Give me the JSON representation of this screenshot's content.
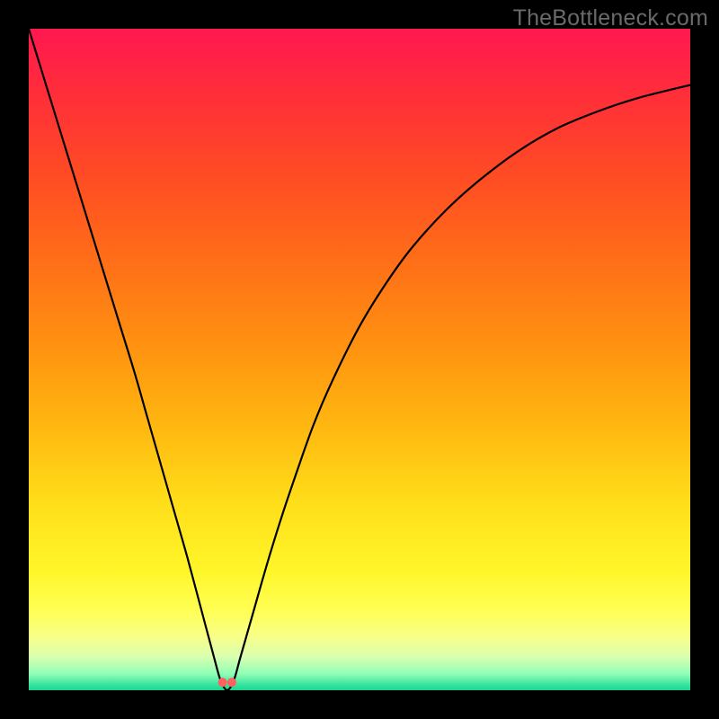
{
  "watermark": "TheBottleneck.com",
  "chart_data": {
    "type": "line",
    "title": "",
    "xlabel": "",
    "ylabel": "",
    "xlim": [
      0,
      100
    ],
    "ylim": [
      0,
      100
    ],
    "grid": false,
    "legend": false,
    "background_gradient_stops": [
      {
        "offset": 0.0,
        "color": "#ff1850"
      },
      {
        "offset": 0.1,
        "color": "#ff2e39"
      },
      {
        "offset": 0.22,
        "color": "#ff4b24"
      },
      {
        "offset": 0.35,
        "color": "#ff6e18"
      },
      {
        "offset": 0.48,
        "color": "#ff9210"
      },
      {
        "offset": 0.6,
        "color": "#ffb710"
      },
      {
        "offset": 0.72,
        "color": "#ffdf1a"
      },
      {
        "offset": 0.82,
        "color": "#fff62a"
      },
      {
        "offset": 0.88,
        "color": "#ffff55"
      },
      {
        "offset": 0.92,
        "color": "#f8ff8a"
      },
      {
        "offset": 0.95,
        "color": "#d8ffb0"
      },
      {
        "offset": 0.975,
        "color": "#90ffb6"
      },
      {
        "offset": 0.99,
        "color": "#40e6a0"
      },
      {
        "offset": 1.0,
        "color": "#18d690"
      }
    ],
    "series": [
      {
        "name": "bottleneck-curve",
        "x": [
          0,
          2,
          4,
          6,
          8,
          10,
          12,
          14,
          16,
          18,
          20,
          22,
          24,
          26,
          28,
          29,
          30,
          31,
          32,
          34,
          36,
          38,
          40,
          43,
          46,
          50,
          54,
          58,
          63,
          68,
          74,
          80,
          86,
          92,
          100
        ],
        "y": [
          100,
          93.5,
          87,
          80.5,
          74,
          67.5,
          61,
          54.5,
          48,
          41,
          34,
          27,
          20,
          12.5,
          5,
          1.5,
          0,
          1.5,
          5,
          12,
          19,
          25.5,
          31.5,
          40,
          47,
          55,
          61.5,
          67,
          72.5,
          77,
          81.5,
          85,
          87.5,
          89.5,
          91.5
        ]
      }
    ],
    "markers": [
      {
        "name": "notch-dot-1",
        "x": 29.3,
        "y": 1.2,
        "color": "#ff6060",
        "r": 5
      },
      {
        "name": "notch-dot-2",
        "x": 30.7,
        "y": 1.2,
        "color": "#ff6060",
        "r": 5
      }
    ],
    "notch_x": 30
  }
}
